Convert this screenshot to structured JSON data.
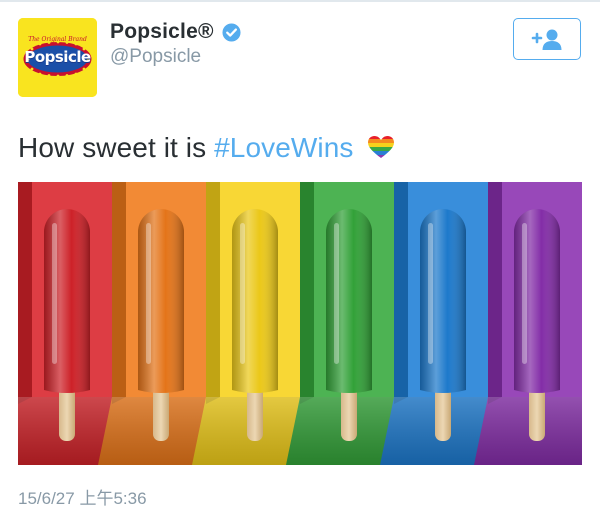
{
  "account": {
    "display_name": "Popsicle®",
    "handle": "@Popsicle",
    "avatar": {
      "logo_text": "Popsicle",
      "logo_tagline": "The Original Brand"
    },
    "verified": true,
    "follow_icon": "add-user-icon"
  },
  "tweet": {
    "text": "How sweet it is",
    "hashtag": "#LoveWins",
    "emoji": "rainbow-heart-icon"
  },
  "media": {
    "description_colors": [
      "#d8232a",
      "#f07a1a",
      "#f7d21a",
      "#35a93b",
      "#1e7fd6",
      "#8a2fb0"
    ],
    "popsicle_count": 6
  },
  "timestamp": "15/6/27 上午5:36",
  "colors": {
    "accent": "#55acee",
    "text": "#292f33",
    "muted": "#8899a6",
    "avatar_bg": "#f9e41f"
  }
}
